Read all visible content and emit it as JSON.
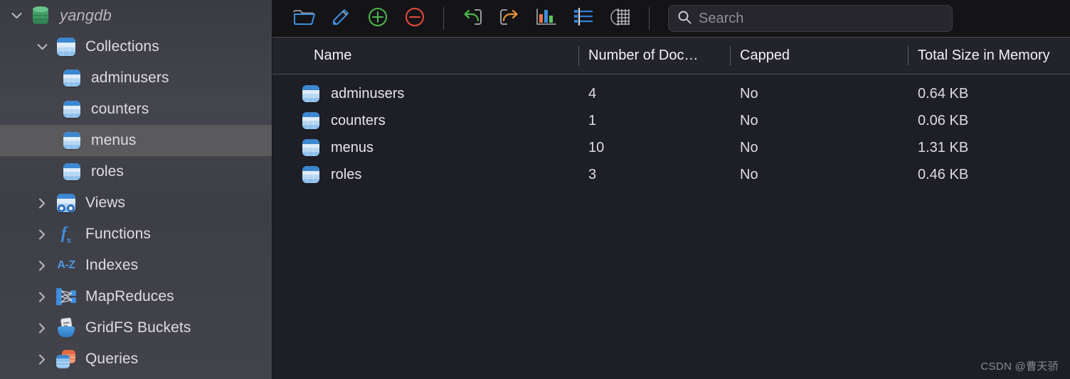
{
  "sidebar": {
    "database": {
      "label": "yangdb",
      "icon": "database-icon",
      "expanded": true,
      "color": "#3f9a62"
    },
    "tree": [
      {
        "label": "Collections",
        "icon": "collection-icon",
        "level": 2,
        "twisty": "chevron-down-icon",
        "selected": false
      },
      {
        "label": "adminusers",
        "icon": "collection-icon",
        "level": 3,
        "twisty": "",
        "selected": false
      },
      {
        "label": "counters",
        "icon": "collection-icon",
        "level": 3,
        "twisty": "",
        "selected": false
      },
      {
        "label": "menus",
        "icon": "collection-icon",
        "level": 3,
        "twisty": "",
        "selected": true
      },
      {
        "label": "roles",
        "icon": "collection-icon",
        "level": 3,
        "twisty": "",
        "selected": false
      },
      {
        "label": "Views",
        "icon": "views-icon",
        "level": 2,
        "twisty": "chevron-right-icon",
        "selected": false
      },
      {
        "label": "Functions",
        "icon": "functions-fx-icon",
        "level": 2,
        "twisty": "chevron-right-icon",
        "selected": false
      },
      {
        "label": "Indexes",
        "icon": "indexes-az-icon",
        "level": 2,
        "twisty": "chevron-right-icon",
        "selected": false
      },
      {
        "label": "MapReduces",
        "icon": "mapreduce-icon",
        "level": 2,
        "twisty": "chevron-right-icon",
        "selected": false
      },
      {
        "label": "GridFS Buckets",
        "icon": "gridfs-bucket-icon",
        "level": 2,
        "twisty": "chevron-right-icon",
        "selected": false
      },
      {
        "label": "Queries",
        "icon": "queries-icon",
        "level": 2,
        "twisty": "chevron-right-icon",
        "selected": false
      }
    ]
  },
  "toolbar": {
    "buttons": [
      {
        "name": "open-folder-button",
        "icon": "folder-icon",
        "color": "#3d8ede"
      },
      {
        "name": "edit-button",
        "icon": "pencil-icon",
        "color": "#3d8ede"
      },
      {
        "name": "add-button",
        "icon": "plus-circle-icon",
        "color": "#4cb84c"
      },
      {
        "name": "remove-button",
        "icon": "minus-circle-icon",
        "color": "#e74c3c"
      },
      {
        "name": "import-button",
        "icon": "import-arrow-icon",
        "color": "#4cb84c"
      },
      {
        "name": "export-button",
        "icon": "export-arrow-icon",
        "color": "#e8922e"
      },
      {
        "name": "chart-button",
        "icon": "bar-chart-icon",
        "color": "#3d8ede"
      },
      {
        "name": "list-view-button",
        "icon": "list-icon",
        "color": "#3d8ede"
      },
      {
        "name": "grid-view-button",
        "icon": "grid-table-icon",
        "color": "#9a9aa2"
      }
    ]
  },
  "search": {
    "placeholder": "Search",
    "value": "",
    "icon": "search-icon"
  },
  "table": {
    "columns": [
      {
        "key": "name",
        "label": "Name"
      },
      {
        "key": "docs",
        "label": "Number of Doc…"
      },
      {
        "key": "capped",
        "label": "Capped"
      },
      {
        "key": "size",
        "label": "Total Size in Memory"
      }
    ],
    "rows": [
      {
        "icon": "collection-icon",
        "name": "adminusers",
        "docs": "4",
        "capped": "No",
        "size": "0.64 KB"
      },
      {
        "icon": "collection-icon",
        "name": "counters",
        "docs": "1",
        "capped": "No",
        "size": "0.06 KB"
      },
      {
        "icon": "collection-icon",
        "name": "menus",
        "docs": "10",
        "capped": "No",
        "size": "1.31 KB"
      },
      {
        "icon": "collection-icon",
        "name": "roles",
        "docs": "3",
        "capped": "No",
        "size": "0.46 KB"
      }
    ]
  },
  "watermark": {
    "text": "CSDN @曹天骄"
  }
}
